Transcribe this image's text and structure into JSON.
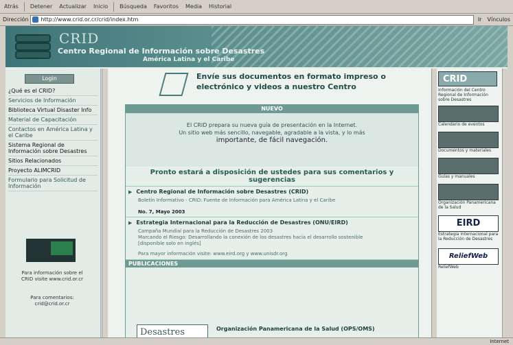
{
  "toolbar": {
    "back": "Atrás",
    "stop": "Detener",
    "refresh": "Actualizar",
    "home": "Inicio",
    "search": "Búsqueda",
    "favorites": "Favoritos",
    "media": "Media",
    "history": "Historial"
  },
  "address": {
    "label": "Dirección",
    "url": "http://www.crid.or.cr/crid/index.htm",
    "go": "Ir",
    "links": "Vínculos"
  },
  "banner": {
    "logo_text": "CRID",
    "title": "Centro Regional de Información sobre Desastres",
    "subtitle": "América Latina y el Caribe"
  },
  "left": {
    "login": "Login",
    "menu": [
      "¿Qué es el CRID?",
      "Servicios de Información",
      "Biblioteca Virtual Disaster Info",
      "Material de Capacitación",
      "Contactos en América Latina y el Caribe",
      "Sistema Regional de Información sobre Desastres",
      "Sitios Relacionados",
      "Proyecto ALIMCRID",
      "Formulario para Solicitud de Información"
    ],
    "note1": "Para información sobre el CRID visite www.crid.or.cr",
    "note2": "Para comentarios: crid@crid.or.cr"
  },
  "center": {
    "envio": "Envíe sus documentos en formato impreso o electrónico y videos a nuestro Centro",
    "nuevo_header": "NUEVO",
    "nuevo_line1": "El CRID prepara su nueva guía de presentación en la Internet.",
    "nuevo_line2": "Un sitio web más sencillo, navegable, agradable a la vista, y lo más",
    "nuevo_line3": "importante, de fácil navegación.",
    "pronto": "Pronto estará a disposición de ustedes para sus comentarios y sugerencias",
    "item1_title": "Centro Regional de Información sobre Desastres (CRID)",
    "item1_line": "Boletín Informativo - CRID: Fuente de Información para América Latina y el Caribe",
    "item1_bold": "No. 7, Mayo 2003",
    "item2_title": "Estrategia Internacional para la Reducción de Desastres (ONU/EIRD)",
    "item2_line1": "Campaña Mundial para la Reducción de Desastres 2003",
    "item2_line2": "Marcando el Riesgo: Desarrollando la conexión de los desastres hacia el desarrollo sostenible",
    "item2_line3": "[disponible solo en inglés]",
    "item2_line4": "Para mayor información visite: www.eird.org y www.unisdr.org",
    "pubs_header": "PUBLICACIONES",
    "desastres": "Desastres",
    "ops": "Organización Panamericana de la Salud (OPS/OMS)"
  },
  "right": {
    "crid_thumb": "CRID",
    "captions": [
      "Información del Centro Regional de Información sobre Desastres",
      "Calendario de eventos",
      "Documentos y materiales",
      "Guías y manuales",
      "Organización Panamericana de la Salud",
      "Estrategia Internacional para la Reducción de Desastres",
      "ReliefWeb"
    ],
    "eird": "EIRD",
    "relief": "ReliefWeb"
  },
  "status": {
    "zone": "Internet"
  }
}
